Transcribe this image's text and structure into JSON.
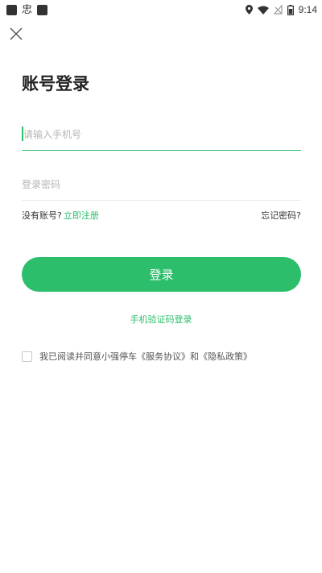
{
  "status_bar": {
    "time": "9:14",
    "left_glyph": "忠",
    "icons": [
      "notification-square-icon",
      "app-icon",
      "location-icon",
      "wifi-icon",
      "no-sim-icon",
      "battery-icon"
    ]
  },
  "header": {
    "close_icon": "close-icon"
  },
  "title": "账号登录",
  "phone_field": {
    "placeholder": "请输入手机号",
    "value": ""
  },
  "password_field": {
    "placeholder": "登录密码",
    "value": ""
  },
  "links": {
    "no_account": "没有账号?",
    "register": "立即注册",
    "forgot": "忘记密码?"
  },
  "login_button": "登录",
  "sms_login": "手机验证码登录",
  "agreement": {
    "text": "我已阅读并同意小强停车《服务协议》和《隐私政策》",
    "checked": false
  },
  "colors": {
    "accent": "#2dbe6c",
    "text": "#222222",
    "placeholder": "#b5b5b5"
  }
}
